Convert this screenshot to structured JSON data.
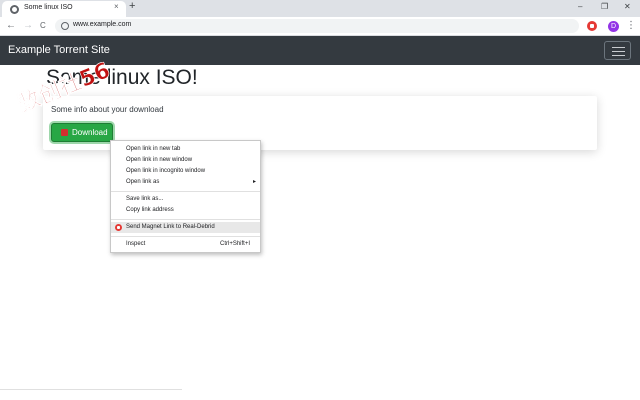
{
  "browser": {
    "tab_title": "Some linux ISO",
    "tab_close": "×",
    "new_tab": "+",
    "win_min": "–",
    "win_restore": "❐",
    "win_close": "✕",
    "back": "←",
    "forward": "→",
    "reload": "C",
    "url": "www.example.com",
    "avatar_letter": "D",
    "menu": "⋮"
  },
  "navbar": {
    "brand": "Example Torrent Site"
  },
  "page": {
    "title": "Some linux ISO!",
    "info": "Some info about your download",
    "download_label": "Download"
  },
  "context_menu": {
    "items": [
      {
        "label": "Open link in new tab",
        "shortcut": ""
      },
      {
        "label": "Open link in new window",
        "shortcut": ""
      },
      {
        "label": "Open link in incognito window",
        "shortcut": ""
      },
      {
        "label": "Open link as",
        "shortcut": "",
        "submenu": "▸"
      },
      {
        "label": "Save link as...",
        "shortcut": ""
      },
      {
        "label": "Copy link address",
        "shortcut": ""
      },
      {
        "label": "Send Magnet Link to Real-Debrid",
        "shortcut": ""
      },
      {
        "label": "Inspect",
        "shortcut": "Ctrl+Shift+I"
      }
    ]
  },
  "watermark": {
    "text": "数创社56"
  },
  "colors": {
    "navbar_bg": "#343a40",
    "button_green": "#28a745",
    "extension_red": "#e53935",
    "watermark_red": "#c01010"
  }
}
